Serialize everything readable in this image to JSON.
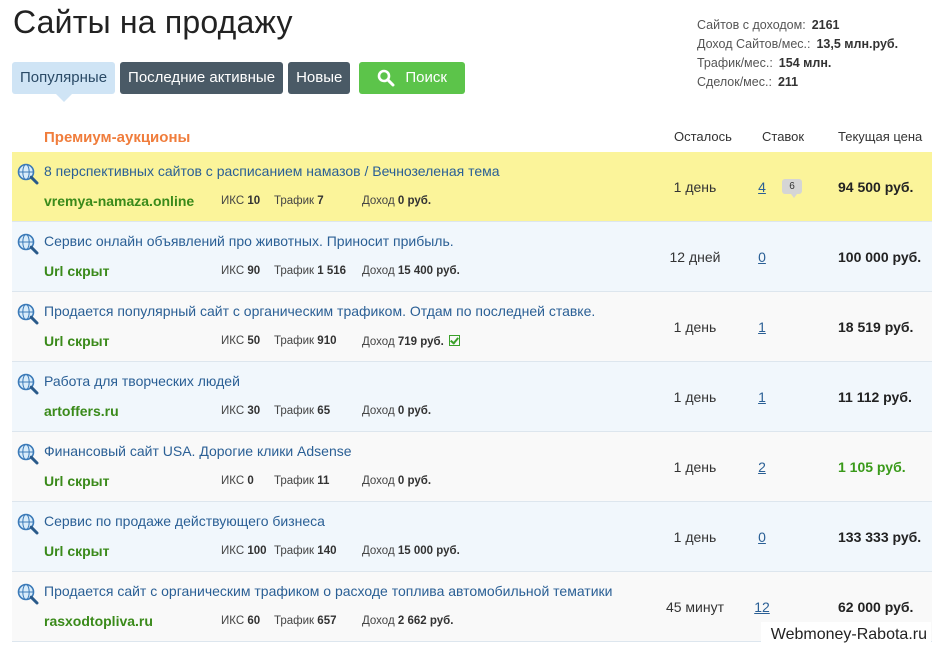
{
  "page": {
    "title": "Сайты на продажу"
  },
  "stats": [
    {
      "label": "Сайтов с доходом:",
      "value": "2161"
    },
    {
      "label": "Доход Сайтов/мес.:",
      "value": "13,5 млн.руб."
    },
    {
      "label": "Трафик/мес.:",
      "value": "154 млн."
    },
    {
      "label": "Сделок/мес.:",
      "value": "211"
    }
  ],
  "tabs": {
    "popular": "Популярные",
    "last_active": "Последние активные",
    "new": "Новые",
    "search": "Поиск"
  },
  "table": {
    "section": "Премиум-аукционы",
    "col_left": "Осталось",
    "col_bids": "Ставок",
    "col_price": "Текущая цена",
    "iks_label": "ИКС",
    "traffic_label": "Трафик",
    "income_label": "Доход",
    "rows": [
      {
        "title": "8 перспективных сайтов с расписанием намазов / Вечнозеленая тема",
        "url": "vremya-namaza.online",
        "iks": "10",
        "traffic": "7",
        "income": "0 руб.",
        "left": "1 день",
        "bids": "4",
        "bubble": "6",
        "price": "94 500 руб."
      },
      {
        "title": "Сервис онлайн объявлений про животных. Приносит прибыль.",
        "url": "Url скрыт",
        "iks": "90",
        "traffic": "1 516",
        "income": "15 400 руб.",
        "left": "12 дней",
        "bids": "0",
        "price": "100 000 руб."
      },
      {
        "title": "Продается популярный сайт с органическим трафиком. Отдам по последней ставке.",
        "url": "Url скрыт",
        "iks": "50",
        "traffic": "910",
        "income": "719 руб.",
        "left": "1 день",
        "bids": "1",
        "price": "18 519 руб."
      },
      {
        "title": "Работа для творческих людей",
        "url": "artoffers.ru",
        "iks": "30",
        "traffic": "65",
        "income": "0 руб.",
        "left": "1 день",
        "bids": "1",
        "price": "11 112 руб."
      },
      {
        "title": "Финансовый сайт USA. Дорогие клики Adsense",
        "url": "Url скрыт",
        "iks": "0",
        "traffic": "11",
        "income": "0 руб.",
        "left": "1 день",
        "bids": "2",
        "price": "1 105 руб."
      },
      {
        "title": "Сервис по продаже действующего бизнеса",
        "url": "Url скрыт",
        "iks": "100",
        "traffic": "140",
        "income": "15 000 руб.",
        "left": "1 день",
        "bids": "0",
        "price": "133 333 руб."
      },
      {
        "title": "Продается сайт с органическим трафиком о расходе топлива автомобильной тематики",
        "url": "rasxodtopliva.ru",
        "iks": "60",
        "traffic": "657",
        "income": "2 662 руб.",
        "left": "45 минут",
        "bids": "12",
        "price": "62 000 руб."
      }
    ]
  },
  "watermark": "Webmoney-Rabota.ru",
  "colors": {
    "accent_orange": "#f07d3c",
    "link_blue": "#2a5f95",
    "url_green": "#3a8a1a",
    "highlight_yellow": "#fbf49a",
    "search_green": "#5cc44a"
  }
}
